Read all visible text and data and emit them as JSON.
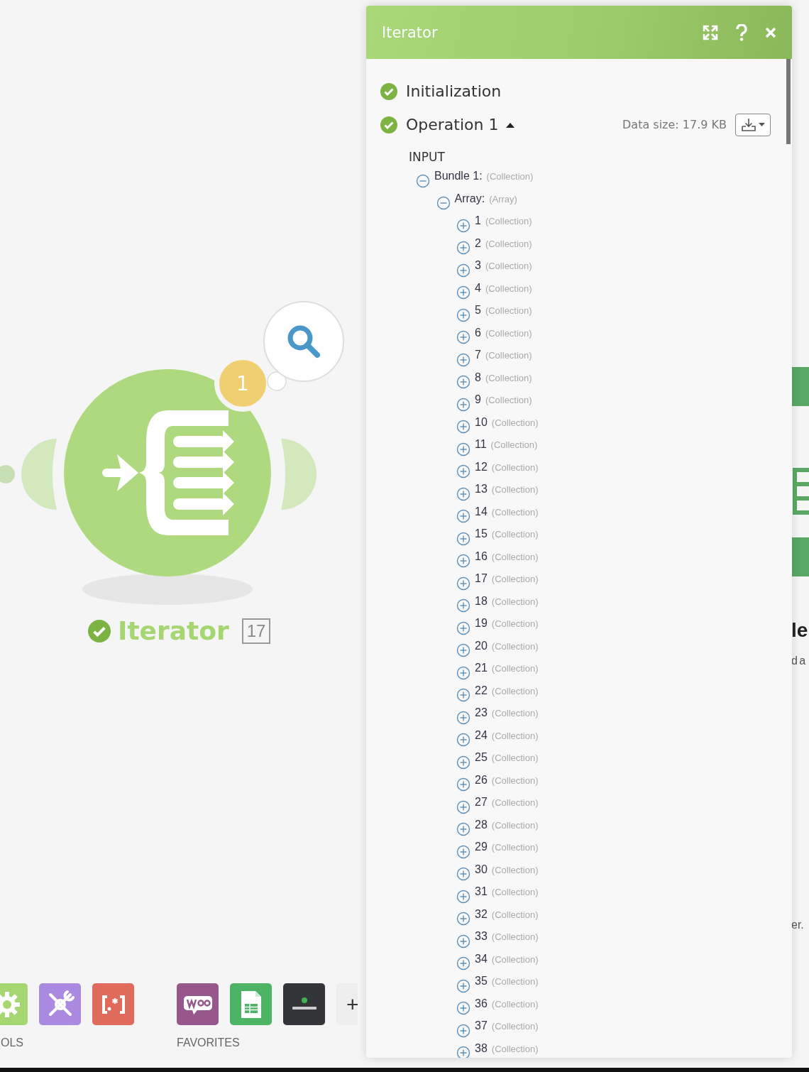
{
  "canvas": {
    "module": {
      "name": "Iterator",
      "count": "17",
      "ok": true,
      "badge": "1"
    },
    "edge_texts": [
      {
        "kind": "heading",
        "text": "le"
      },
      {
        "kind": "body",
        "text": "d a"
      },
      {
        "kind": "note",
        "text": "er."
      }
    ],
    "toolbar": {
      "groups": [
        {
          "label": "OLS",
          "apps": [
            {
              "kind": "gear"
            },
            {
              "kind": "tools"
            },
            {
              "kind": "regex"
            }
          ]
        },
        {
          "label": "FAVORITES",
          "apps": [
            {
              "kind": "woo"
            },
            {
              "kind": "sheets"
            },
            {
              "kind": "quickbooks"
            }
          ]
        }
      ],
      "add_label": "+"
    }
  },
  "panel": {
    "title": "Iterator",
    "sections": [
      {
        "label": "Initialization",
        "ok": true,
        "expanded": false
      },
      {
        "label": "Operation 1",
        "ok": true,
        "expanded": true,
        "data_size": "Data size: 17.9 KB"
      }
    ],
    "io_label": "INPUT",
    "tree": [
      {
        "name": "Bundle 1:",
        "type": "(Collection)",
        "expanded": true,
        "children": [
          {
            "name": "Array:",
            "type": "(Array)",
            "expanded": true,
            "children": [
              {
                "name": "1",
                "type": "(Collection)",
                "expanded": false
              },
              {
                "name": "2",
                "type": "(Collection)",
                "expanded": false
              },
              {
                "name": "3",
                "type": "(Collection)",
                "expanded": false
              },
              {
                "name": "4",
                "type": "(Collection)",
                "expanded": false
              },
              {
                "name": "5",
                "type": "(Collection)",
                "expanded": false
              },
              {
                "name": "6",
                "type": "(Collection)",
                "expanded": false
              },
              {
                "name": "7",
                "type": "(Collection)",
                "expanded": false
              },
              {
                "name": "8",
                "type": "(Collection)",
                "expanded": false
              },
              {
                "name": "9",
                "type": "(Collection)",
                "expanded": false
              },
              {
                "name": "10",
                "type": "(Collection)",
                "expanded": false
              },
              {
                "name": "11",
                "type": "(Collection)",
                "expanded": false
              },
              {
                "name": "12",
                "type": "(Collection)",
                "expanded": false
              },
              {
                "name": "13",
                "type": "(Collection)",
                "expanded": false
              },
              {
                "name": "14",
                "type": "(Collection)",
                "expanded": false
              },
              {
                "name": "15",
                "type": "(Collection)",
                "expanded": false
              },
              {
                "name": "16",
                "type": "(Collection)",
                "expanded": false
              },
              {
                "name": "17",
                "type": "(Collection)",
                "expanded": false
              },
              {
                "name": "18",
                "type": "(Collection)",
                "expanded": false
              },
              {
                "name": "19",
                "type": "(Collection)",
                "expanded": false
              },
              {
                "name": "20",
                "type": "(Collection)",
                "expanded": false
              },
              {
                "name": "21",
                "type": "(Collection)",
                "expanded": false
              },
              {
                "name": "22",
                "type": "(Collection)",
                "expanded": false
              },
              {
                "name": "23",
                "type": "(Collection)",
                "expanded": false
              },
              {
                "name": "24",
                "type": "(Collection)",
                "expanded": false
              },
              {
                "name": "25",
                "type": "(Collection)",
                "expanded": false
              },
              {
                "name": "26",
                "type": "(Collection)",
                "expanded": false
              },
              {
                "name": "27",
                "type": "(Collection)",
                "expanded": false
              },
              {
                "name": "28",
                "type": "(Collection)",
                "expanded": false
              },
              {
                "name": "29",
                "type": "(Collection)",
                "expanded": false
              },
              {
                "name": "30",
                "type": "(Collection)",
                "expanded": false
              },
              {
                "name": "31",
                "type": "(Collection)",
                "expanded": false
              },
              {
                "name": "32",
                "type": "(Collection)",
                "expanded": false
              },
              {
                "name": "33",
                "type": "(Collection)",
                "expanded": false
              },
              {
                "name": "34",
                "type": "(Collection)",
                "expanded": false
              },
              {
                "name": "35",
                "type": "(Collection)",
                "expanded": false
              },
              {
                "name": "36",
                "type": "(Collection)",
                "expanded": false
              },
              {
                "name": "37",
                "type": "(Collection)",
                "expanded": false
              },
              {
                "name": "38",
                "type": "(Collection)",
                "expanded": false
              }
            ]
          }
        ]
      }
    ]
  }
}
